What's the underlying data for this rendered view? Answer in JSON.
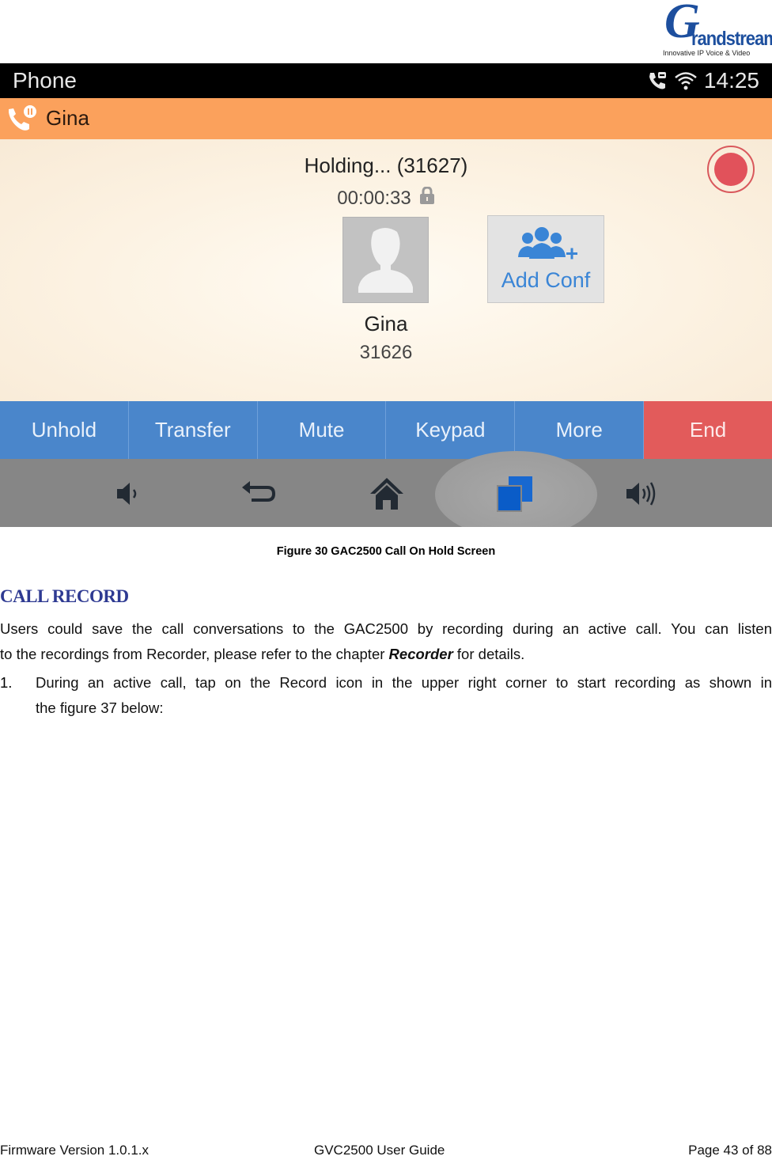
{
  "logo": {
    "letter": "G",
    "brand": "randstream",
    "tagline": "Innovative IP Voice & Video"
  },
  "screen": {
    "statusbar": {
      "title": "Phone",
      "time": "14:25",
      "icons": [
        "voicemail-call-icon",
        "wifi-icon"
      ]
    },
    "callerbar": {
      "name": "Gina",
      "icon": "call-hold-icon",
      "color": "#fba15c"
    },
    "call": {
      "status": "Holding... (31627)",
      "duration": "00:00:33",
      "lock_icon": "lock-icon",
      "contact_name": "Gina",
      "contact_number": "31626",
      "add_conf_label": "Add Conf",
      "record_color": "#e1525b"
    },
    "actions": [
      {
        "label": "Unhold"
      },
      {
        "label": "Transfer"
      },
      {
        "label": "Mute"
      },
      {
        "label": "Keypad"
      },
      {
        "label": "More"
      },
      {
        "label": "End"
      }
    ],
    "action_colors": {
      "primary": "#4a86cb",
      "end": "#e25b5b"
    },
    "nav": [
      "volume-down-icon",
      "back-icon",
      "home-icon",
      "recent-apps-icon",
      "volume-up-icon"
    ]
  },
  "document": {
    "caption": "Figure 30 GAC2500 Call On Hold Screen",
    "heading": "CALL RECORD",
    "para1_line1": "Users could save the call conversations to the GAC2500 by recording during an active call. You can listen",
    "para1_line2_pre": "to the recordings from Recorder, please refer to the chapter ",
    "para1_line2_bold": "Recorder",
    "para1_line2_post": " for details.",
    "step1_number": "1.",
    "step1_line1": "During an active call, tap on the Record icon in the upper right corner to start recording as shown in",
    "step1_line2": "the figure 37 below:"
  },
  "footer": {
    "left": "Firmware Version 1.0.1.x",
    "center": "GVC2500 User Guide",
    "right": "Page 43 of 88"
  }
}
